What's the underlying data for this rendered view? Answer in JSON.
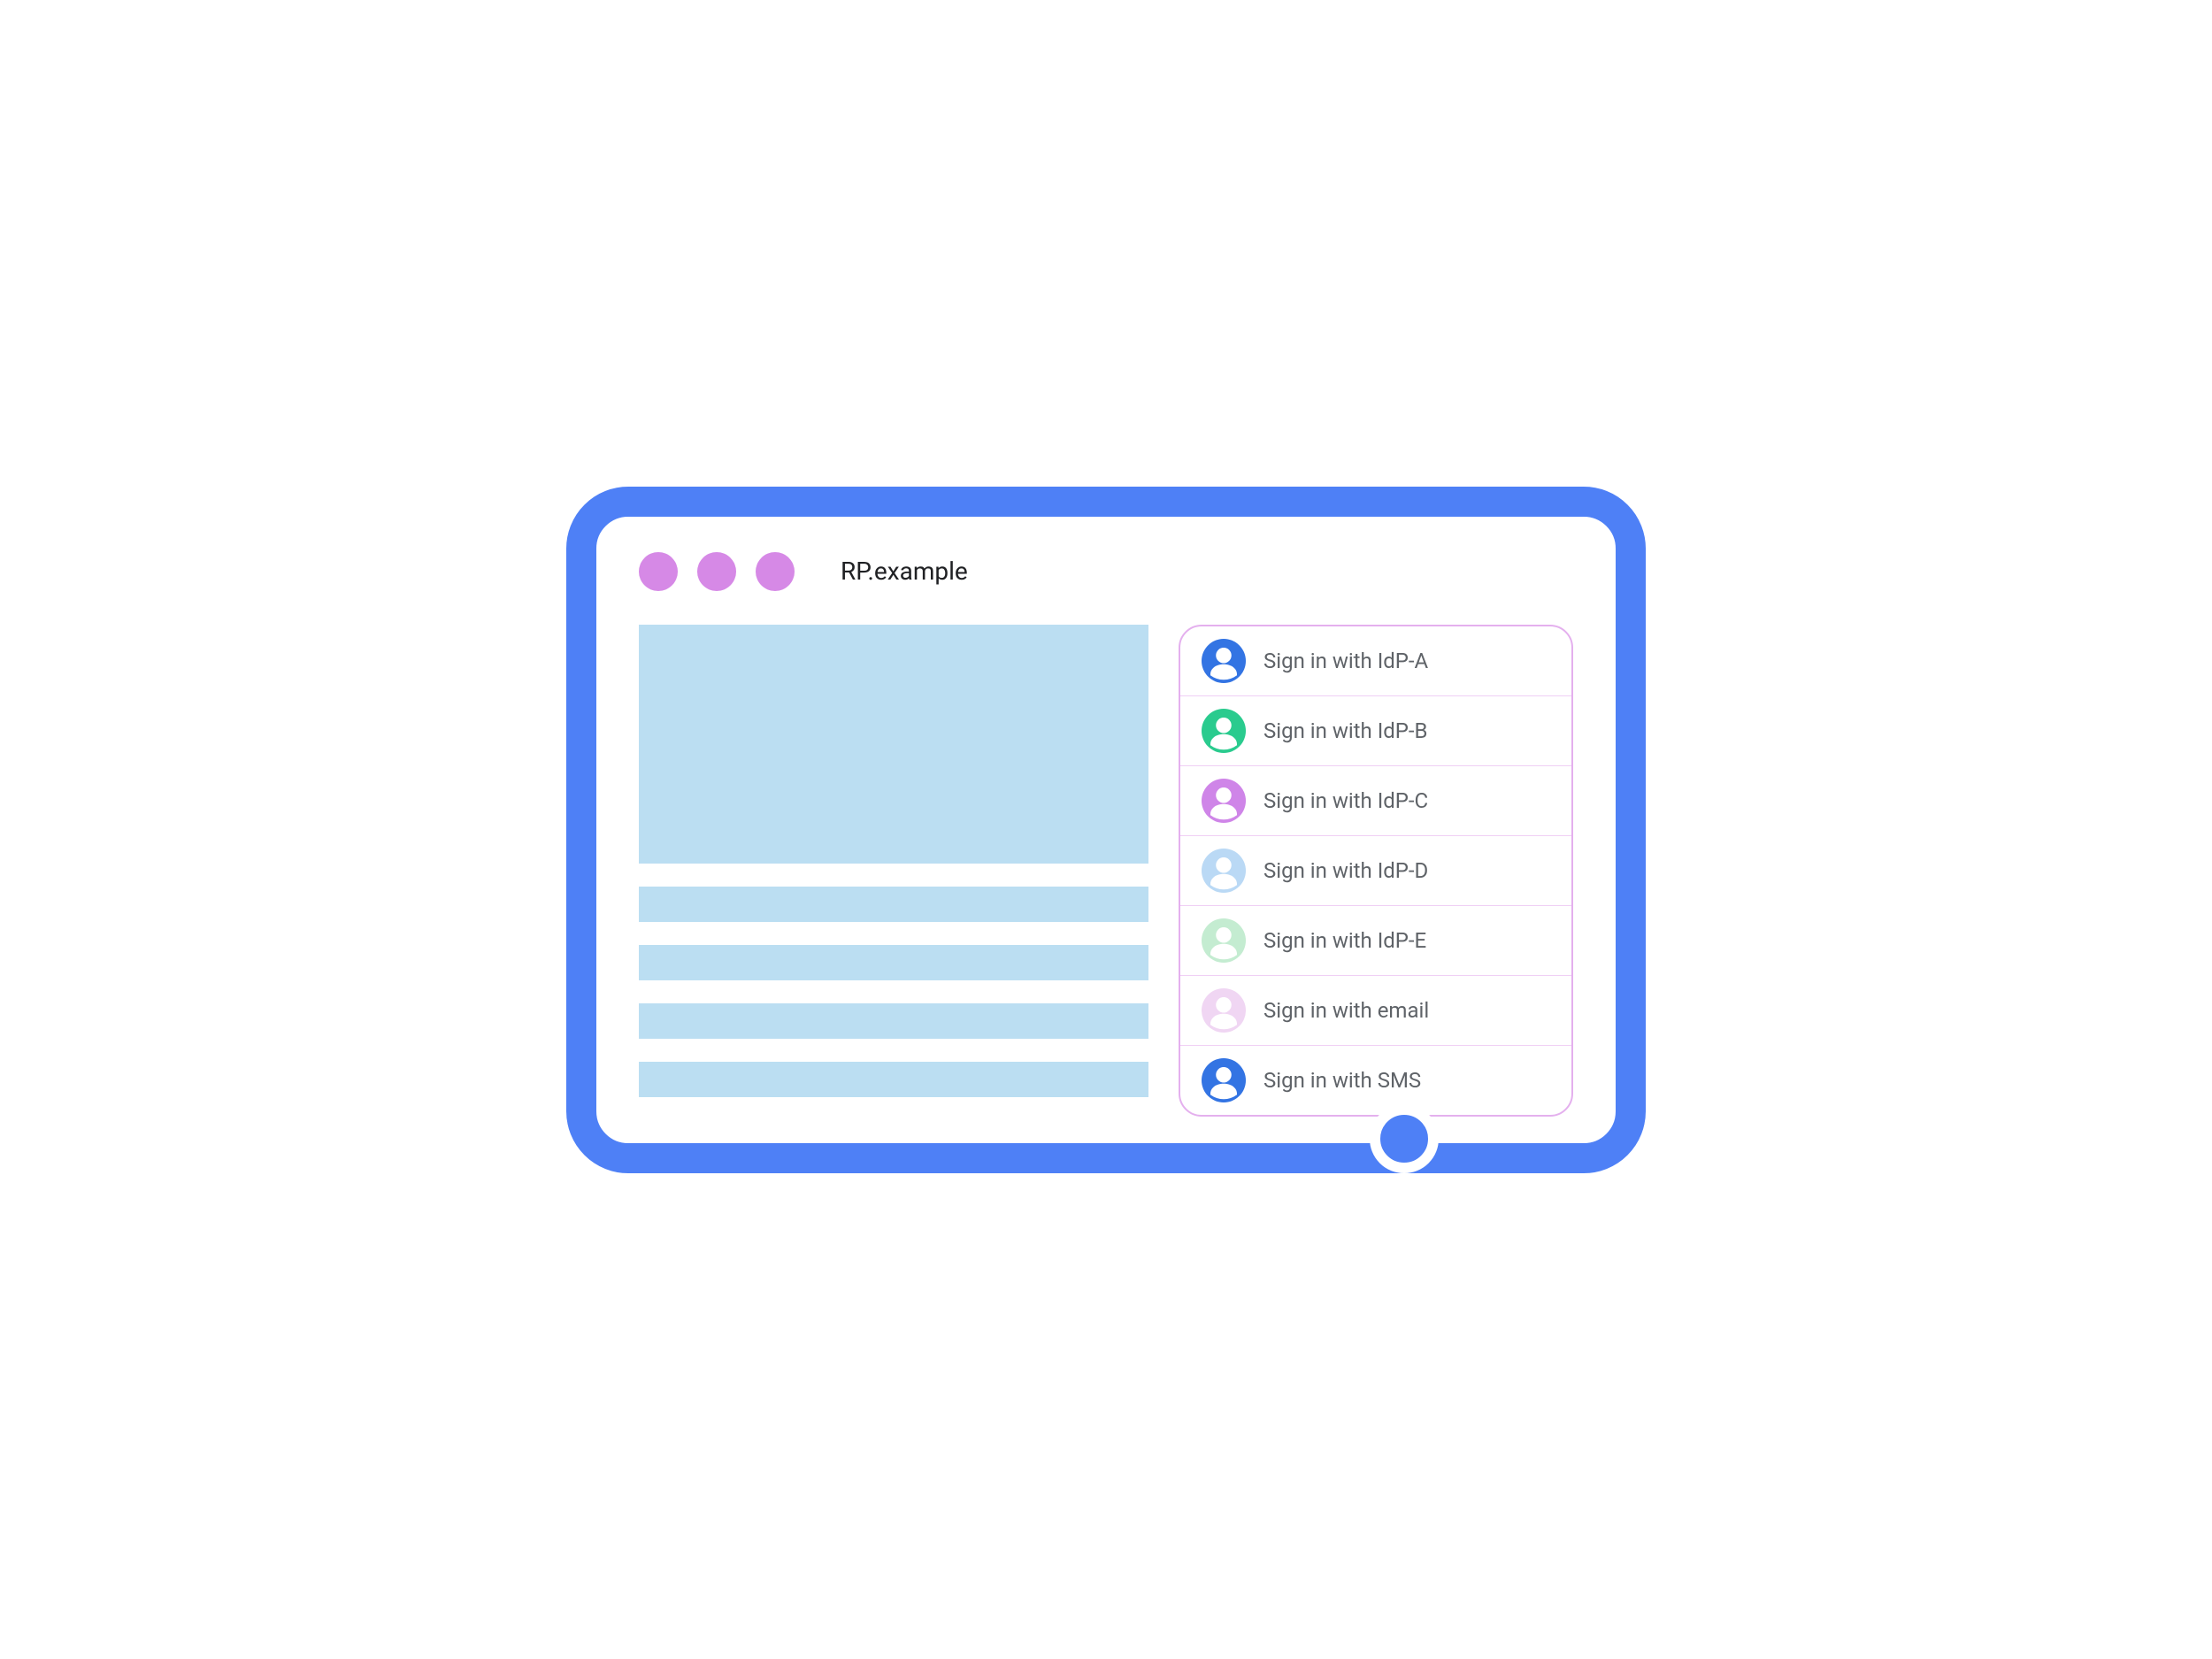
{
  "site_title": "RP.example",
  "colors": {
    "frame": "#4e80f6",
    "traffic_light": "#d689e6",
    "content_block": "#bbdef2",
    "panel_border": "#e4b0ee",
    "panel_divider": "#f0d0f5",
    "label_text": "#5f6368"
  },
  "signin_options": [
    {
      "label": "Sign in with IdP-A",
      "icon_color": "#3374e3"
    },
    {
      "label": "Sign in with IdP-B",
      "icon_color": "#2acb8e"
    },
    {
      "label": "Sign in with IdP-C",
      "icon_color": "#cf85e8"
    },
    {
      "label": "Sign in with IdP-D",
      "icon_color": "#bad9f5"
    },
    {
      "label": "Sign in with IdP-E",
      "icon_color": "#c4ecd1"
    },
    {
      "label": "Sign in with email",
      "icon_color": "#f0d6f3"
    },
    {
      "label": "Sign in with SMS",
      "icon_color": "#3374e3"
    }
  ]
}
